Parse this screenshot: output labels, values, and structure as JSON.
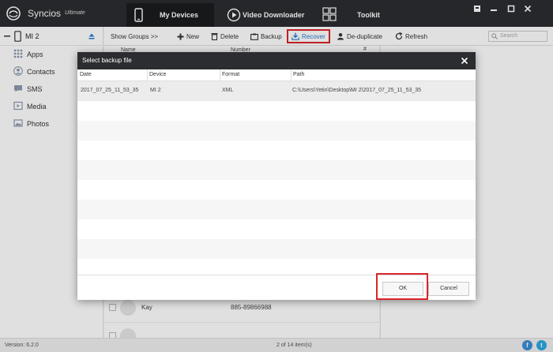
{
  "app": {
    "name": "Syncios",
    "edition": "Ultimate"
  },
  "nav": [
    {
      "label": "My Devices",
      "icon": "phone-icon",
      "active": true
    },
    {
      "label": "Video Downloader",
      "icon": "play-icon",
      "active": false
    },
    {
      "label": "Toolkit",
      "icon": "grid-icon",
      "active": false
    }
  ],
  "window_controls": [
    "menu-icon",
    "minimize-icon",
    "maximize-icon",
    "close-icon"
  ],
  "sidebar": {
    "device": "MI 2",
    "items": [
      {
        "label": "Apps",
        "icon": "apps-icon"
      },
      {
        "label": "Contacts",
        "icon": "contacts-icon"
      },
      {
        "label": "SMS",
        "icon": "sms-icon"
      },
      {
        "label": "Media",
        "icon": "media-icon"
      },
      {
        "label": "Photos",
        "icon": "photos-icon"
      }
    ]
  },
  "toolbar": {
    "show_groups": "Show Groups >>",
    "new": "New",
    "delete": "Delete",
    "backup": "Backup",
    "recover": "Recover",
    "deduplicate": "De-duplicate",
    "refresh": "Refresh",
    "search_placeholder": "Search"
  },
  "list": {
    "header_name": "Name",
    "header_number": "Number",
    "header_hash": "#",
    "rows": [
      {
        "name": "Kay",
        "number": "885-89866988"
      }
    ]
  },
  "status": {
    "version": "Version: 6.2.0",
    "count": "2 of 14 item(s)"
  },
  "social": [
    {
      "icon": "facebook-icon",
      "glyph": "f",
      "color": "#3b8fd6"
    },
    {
      "icon": "twitter-icon",
      "glyph": "t",
      "color": "#2aa9e0"
    }
  ],
  "dialog": {
    "title": "Select backup file",
    "columns": [
      "Date",
      "Device",
      "Format",
      "Path"
    ],
    "rows": [
      {
        "date": "2017_07_25_11_53_35",
        "device": "MI 2",
        "format": "XML",
        "path": "C:\\Users\\Yetin\\Desktop\\MI 2\\2017_07_25_11_53_35"
      }
    ],
    "ok": "OK",
    "cancel": "Cancel"
  },
  "colors": {
    "accent_red": "#d9252b",
    "titlebar": "#2b2d30",
    "recover_blue": "#2a7fd4"
  }
}
